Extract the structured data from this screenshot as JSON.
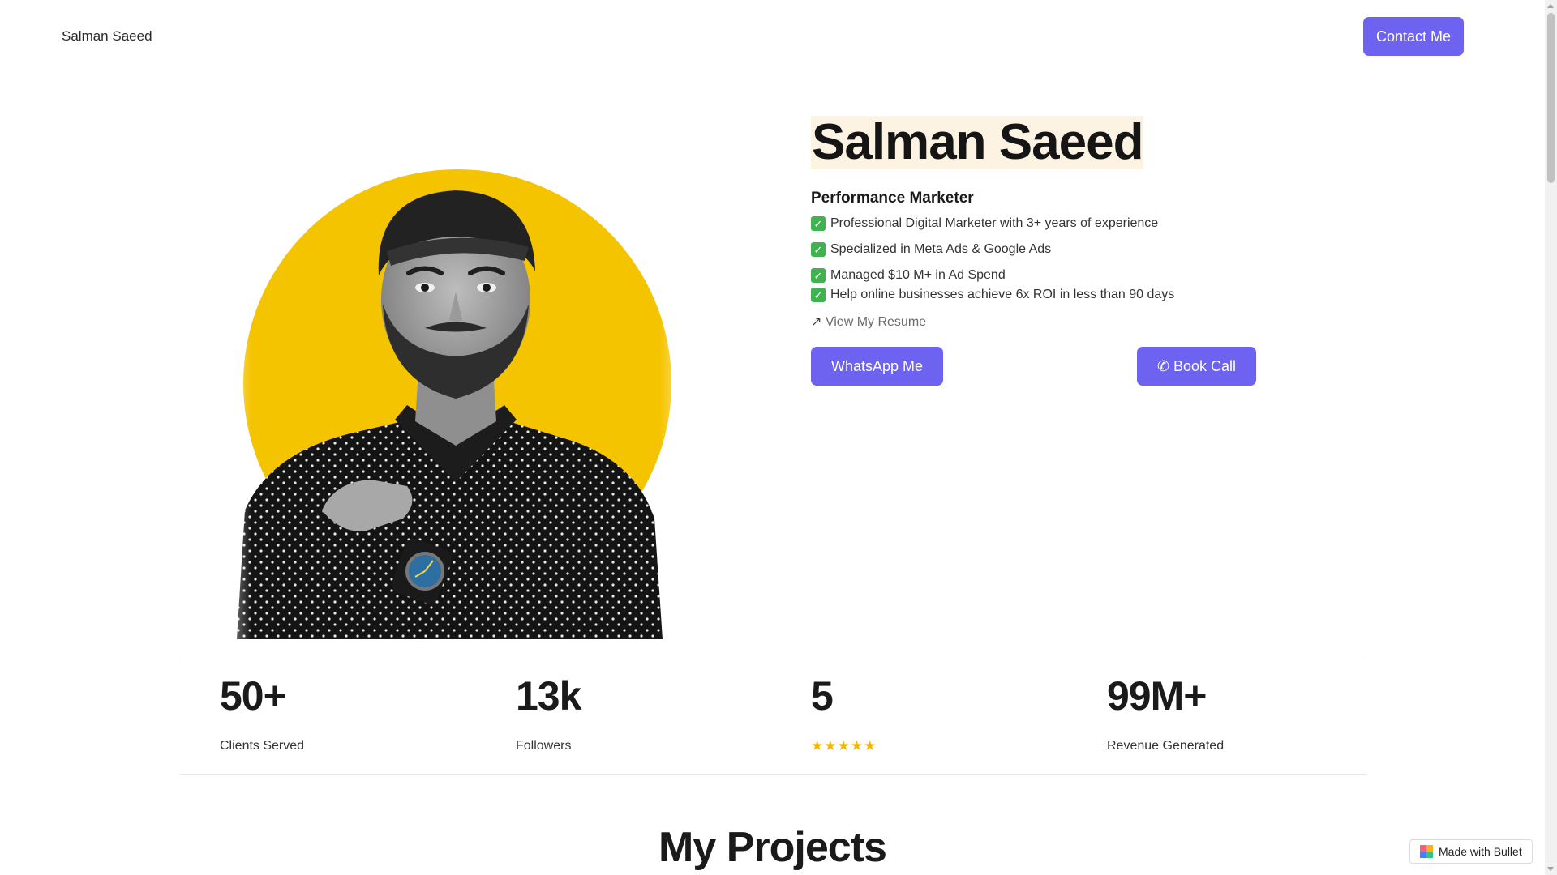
{
  "nav": {
    "brand": "Salman Saeed",
    "contact_label": "Contact Me"
  },
  "hero": {
    "name": "Salman Saeed",
    "role": "Performance Marketer",
    "bullets": [
      "Professional Digital Marketer with 3+ years of experience",
      "Specialized in Meta Ads & Google Ads",
      "Managed $10 M+ in Ad Spend",
      "Help online businesses achieve 6x ROI in less than 90 days"
    ],
    "check_glyph": "✓",
    "resume_arrow": "↗",
    "resume_label": "View My Resume",
    "whatsapp_label": "WhatsApp Me",
    "book_label": "✆ Book Call",
    "photo_bg_color": "#f5c400",
    "photo_icon": "portrait-photo"
  },
  "stats": [
    {
      "value": "50+",
      "label": "Clients Served"
    },
    {
      "value": "13k",
      "label": "Followers"
    },
    {
      "value": "5",
      "rating": 5,
      "stars": "★★★★★"
    },
    {
      "value": "99M+",
      "label": "Revenue Generated"
    }
  ],
  "projects": {
    "title": "My Projects"
  },
  "badge": {
    "label": "Made with Bullet"
  },
  "colors": {
    "accent": "#6e62f0",
    "name_highlight": "#fdf3e3",
    "check": "#3fb34f",
    "star": "#f2b705"
  }
}
